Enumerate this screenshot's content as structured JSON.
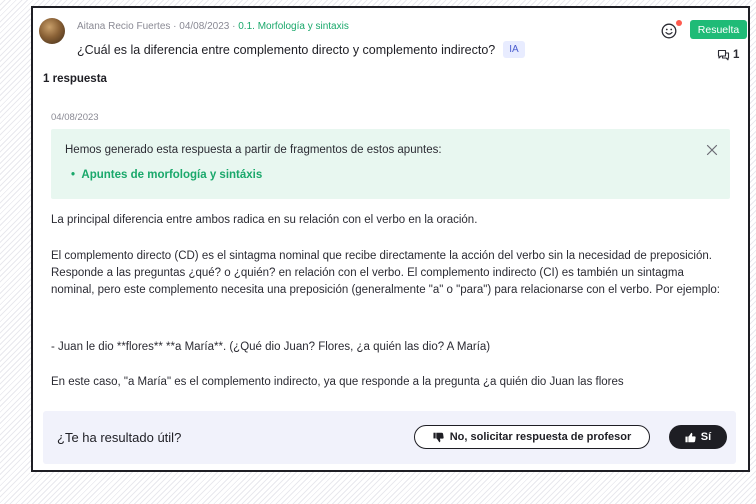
{
  "question": {
    "author": "Aitana Recio Fuertes",
    "separator": " · ",
    "date": "04/08/2023",
    "topic": "0.1. Morfología y sintaxis",
    "title": "¿Cuál es la diferencia entre complemento directo y complemento indirecto?",
    "ia_badge": "IA",
    "status": "Resuelta",
    "comment_count": "1"
  },
  "answers": {
    "count_label": "1 respuesta",
    "date": "04/08/2023",
    "info": {
      "text": "Hemos generado esta respuesta a partir de fragmentos de estos apuntes:",
      "bullet": "•",
      "link": "Apuntes de morfología y sintáxis"
    },
    "paragraphs": [
      "La principal diferencia entre ambos radica en su relación con el verbo en la oración.",
      "El complemento directo (CD) es el sintagma nominal que recibe directamente la acción del verbo sin la necesidad de preposición. Responde a las preguntas ¿qué? o ¿quién? en relación con el verbo. El complemento indirecto (CI) es también un sintagma nominal, pero este complemento necesita una preposición (generalmente \"a\" o \"para\") para relacionarse con el verbo. Por ejemplo:",
      "- Juan le dio **flores** **a María**. (¿Qué dio Juan? Flores, ¿a quién las dio? A María)",
      "En este caso, \"a María\" es el complemento indirecto, ya que responde a la pregunta ¿a quién dio Juan las flores"
    ]
  },
  "feedback": {
    "question": "¿Te ha resultado útil?",
    "no_label": "No, solicitar respuesta de profesor",
    "yes_label": "Sí"
  },
  "colors": {
    "accent_green": "#1fbb77",
    "info_bg": "#e8f7f0",
    "feedback_bg": "#f1f2fb",
    "dark": "#1e1e24"
  },
  "icons": {
    "smiley": "smiley-icon",
    "comment": "comment-icon",
    "close": "close-icon",
    "thumb_down": "thumb-down-icon",
    "thumb_up": "thumb-up-icon"
  }
}
